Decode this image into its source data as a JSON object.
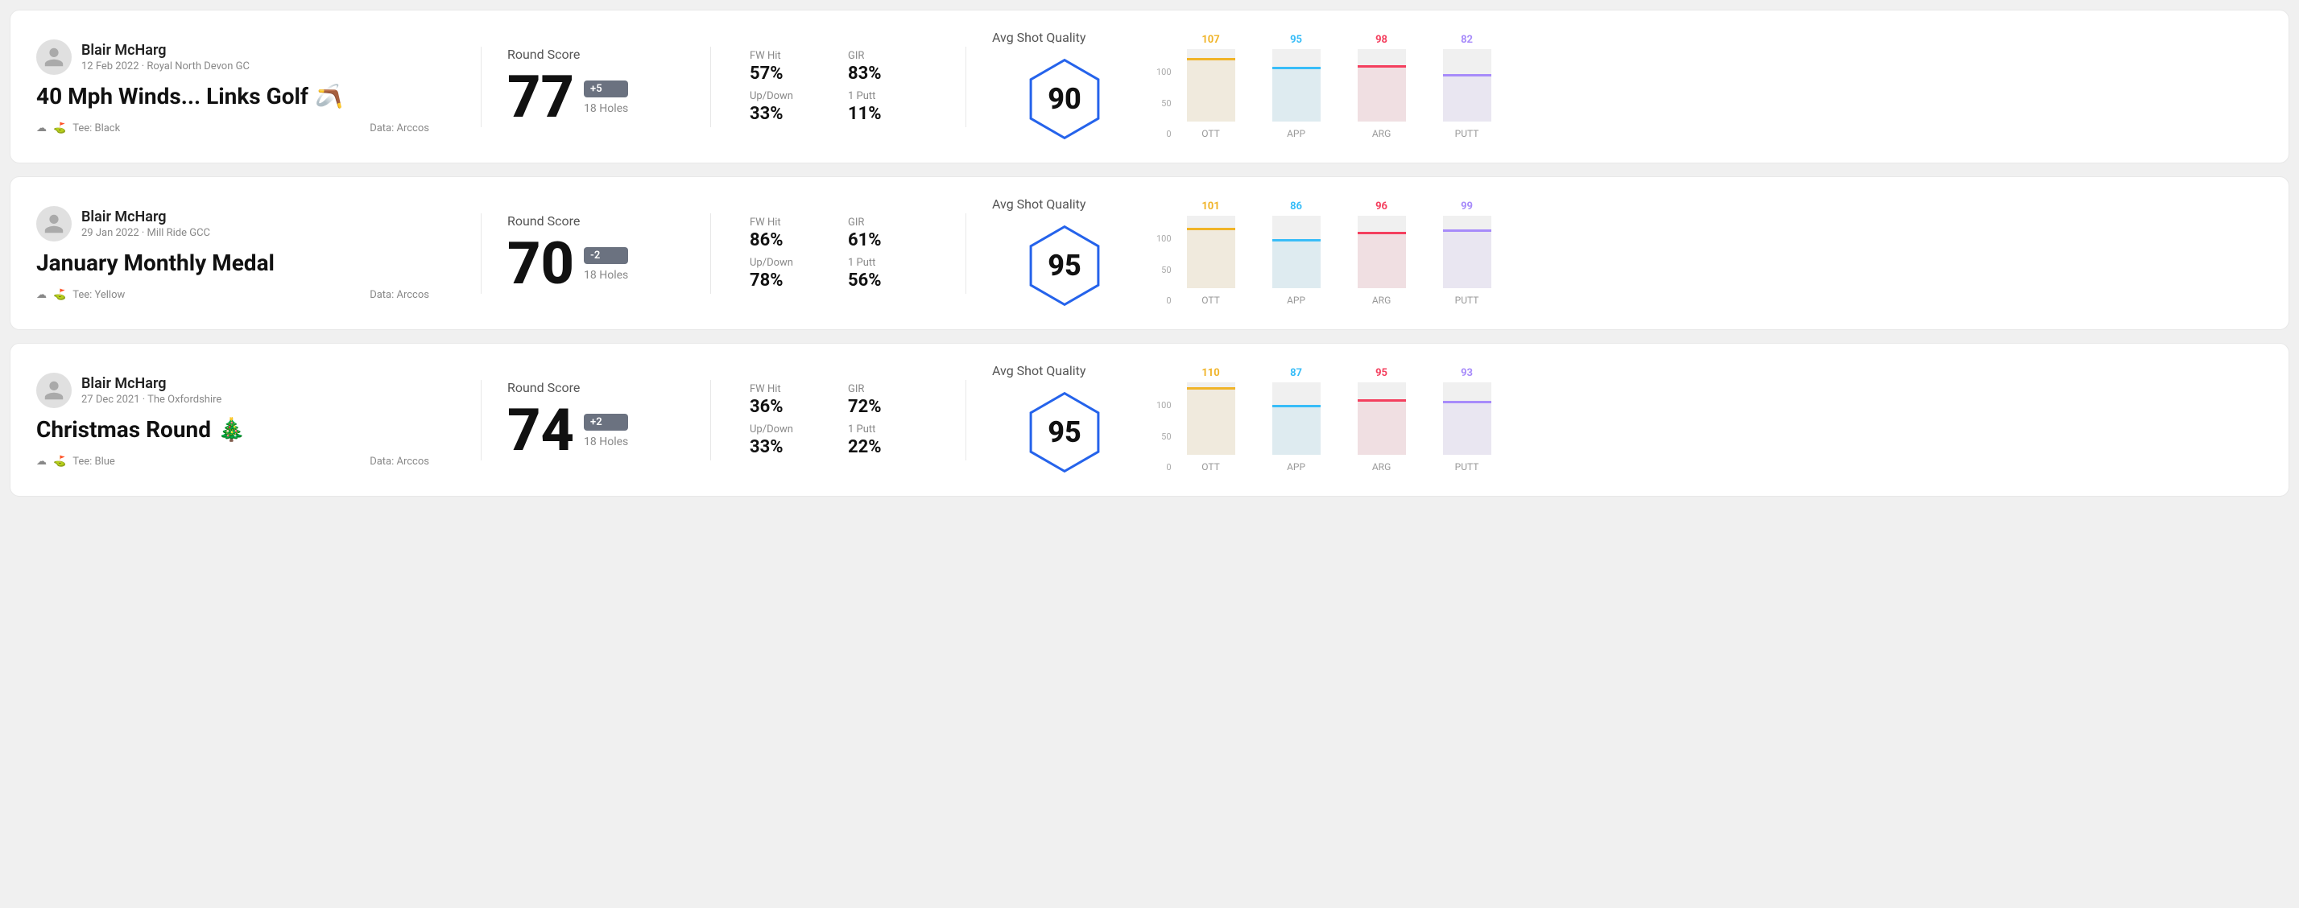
{
  "rounds": [
    {
      "id": "round-1",
      "player": "Blair McHarg",
      "date": "12 Feb 2022",
      "course": "Royal North Devon GC",
      "title": "40 Mph Winds... Links Golf",
      "title_emoji": "🪃",
      "tee": "Black",
      "data_source": "Data: Arccos",
      "score": "77",
      "score_diff": "+5",
      "score_diff_type": "plus",
      "holes": "18 Holes",
      "fw_hit": "57%",
      "gir": "83%",
      "up_down": "33%",
      "one_putt": "11%",
      "avg_quality": "90",
      "chart": {
        "ott": {
          "value": 107,
          "color": "#f0b429",
          "bar_pct": 85
        },
        "app": {
          "value": 95,
          "color": "#38bdf8",
          "bar_pct": 72
        },
        "arg": {
          "value": 98,
          "color": "#f43f5e",
          "bar_pct": 75
        },
        "putt": {
          "value": 82,
          "color": "#a78bfa",
          "bar_pct": 62
        }
      }
    },
    {
      "id": "round-2",
      "player": "Blair McHarg",
      "date": "29 Jan 2022",
      "course": "Mill Ride GCC",
      "title": "January Monthly Medal",
      "title_emoji": "",
      "tee": "Yellow",
      "data_source": "Data: Arccos",
      "score": "70",
      "score_diff": "-2",
      "score_diff_type": "minus",
      "holes": "18 Holes",
      "fw_hit": "86%",
      "gir": "61%",
      "up_down": "78%",
      "one_putt": "56%",
      "avg_quality": "95",
      "chart": {
        "ott": {
          "value": 101,
          "color": "#f0b429",
          "bar_pct": 80
        },
        "app": {
          "value": 86,
          "color": "#38bdf8",
          "bar_pct": 65
        },
        "arg": {
          "value": 96,
          "color": "#f43f5e",
          "bar_pct": 74
        },
        "putt": {
          "value": 99,
          "color": "#a78bfa",
          "bar_pct": 78
        }
      }
    },
    {
      "id": "round-3",
      "player": "Blair McHarg",
      "date": "27 Dec 2021",
      "course": "The Oxfordshire",
      "title": "Christmas Round",
      "title_emoji": "🎄",
      "tee": "Blue",
      "data_source": "Data: Arccos",
      "score": "74",
      "score_diff": "+2",
      "score_diff_type": "plus",
      "holes": "18 Holes",
      "fw_hit": "36%",
      "gir": "72%",
      "up_down": "33%",
      "one_putt": "22%",
      "avg_quality": "95",
      "chart": {
        "ott": {
          "value": 110,
          "color": "#f0b429",
          "bar_pct": 90
        },
        "app": {
          "value": 87,
          "color": "#38bdf8",
          "bar_pct": 66
        },
        "arg": {
          "value": 95,
          "color": "#f43f5e",
          "bar_pct": 73
        },
        "putt": {
          "value": 93,
          "color": "#a78bfa",
          "bar_pct": 71
        }
      }
    }
  ],
  "labels": {
    "round_score": "Round Score",
    "fw_hit": "FW Hit",
    "gir": "GIR",
    "up_down": "Up/Down",
    "one_putt": "1 Putt",
    "avg_shot_quality": "Avg Shot Quality",
    "ott": "OTT",
    "app": "APP",
    "arg": "ARG",
    "putt": "PUTT",
    "y_100": "100",
    "y_50": "50",
    "y_0": "0"
  }
}
